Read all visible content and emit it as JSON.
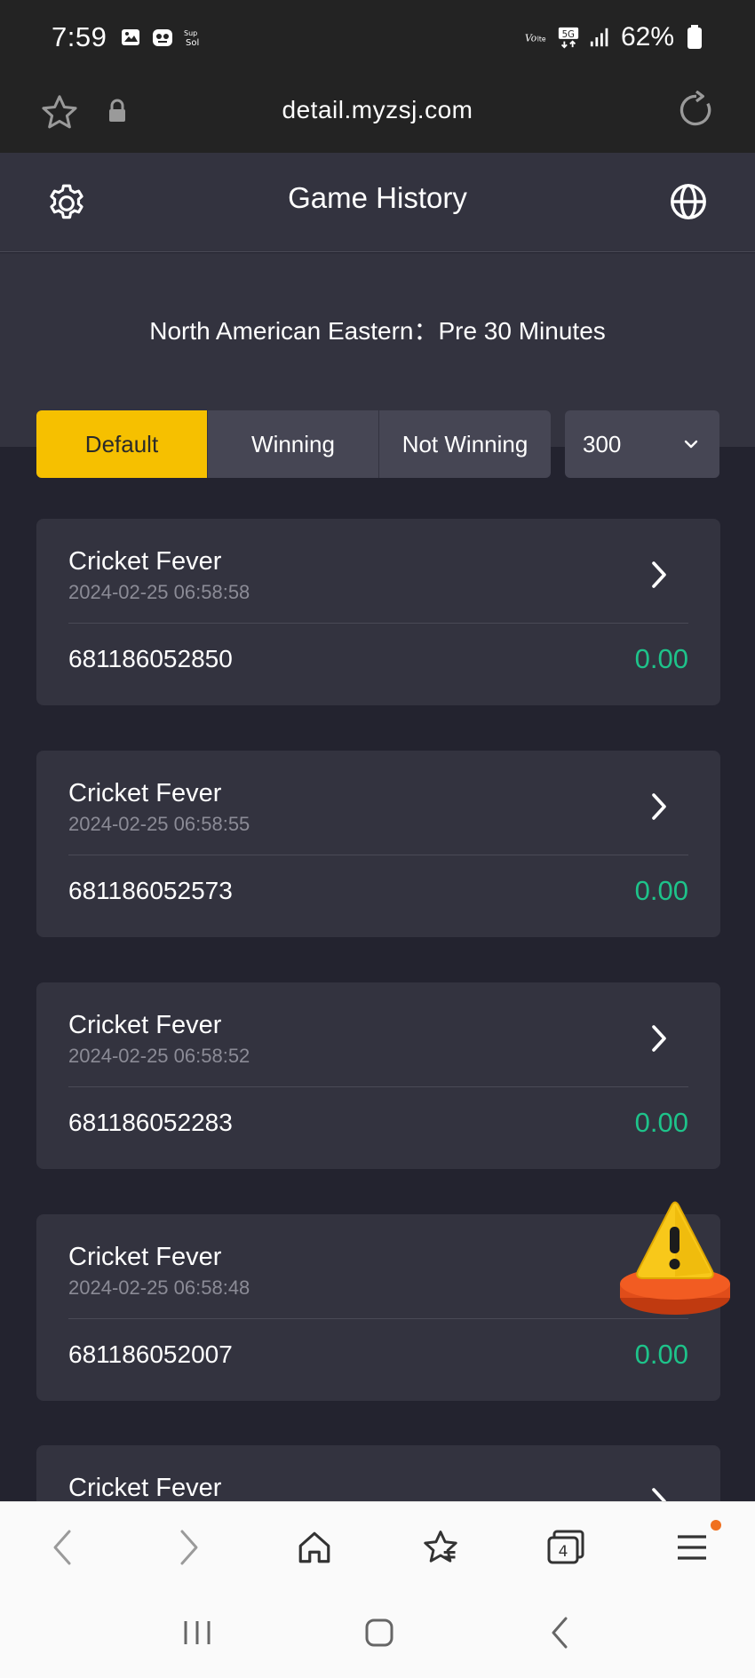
{
  "status_bar": {
    "time": "7:59",
    "battery": "62%",
    "signal_label": "5G"
  },
  "browser": {
    "url": "detail.myzsj.com"
  },
  "header": {
    "title": "Game History"
  },
  "timezone_label": "North American Eastern：Pre 30 Minutes",
  "filters": {
    "tabs": [
      {
        "label": "Default",
        "active": true
      },
      {
        "label": "Winning",
        "active": false
      },
      {
        "label": "Not Winning",
        "active": false
      }
    ],
    "count_select": "300"
  },
  "records": [
    {
      "game": "Cricket Fever",
      "datetime": "2024-02-25 06:58:58",
      "id": "681186052850",
      "amount": "0.00"
    },
    {
      "game": "Cricket Fever",
      "datetime": "2024-02-25 06:58:55",
      "id": "681186052573",
      "amount": "0.00"
    },
    {
      "game": "Cricket Fever",
      "datetime": "2024-02-25 06:58:52",
      "id": "681186052283",
      "amount": "0.00"
    },
    {
      "game": "Cricket Fever",
      "datetime": "2024-02-25 06:58:48",
      "id": "681186052007",
      "amount": "0.00"
    },
    {
      "game": "Cricket Fever"
    }
  ],
  "browser_toolbar": {
    "tabs_count": "4"
  },
  "colors": {
    "accent": "#f6c000",
    "amount": "#1ec38a",
    "background": "#23232f",
    "card": "#33333f"
  }
}
